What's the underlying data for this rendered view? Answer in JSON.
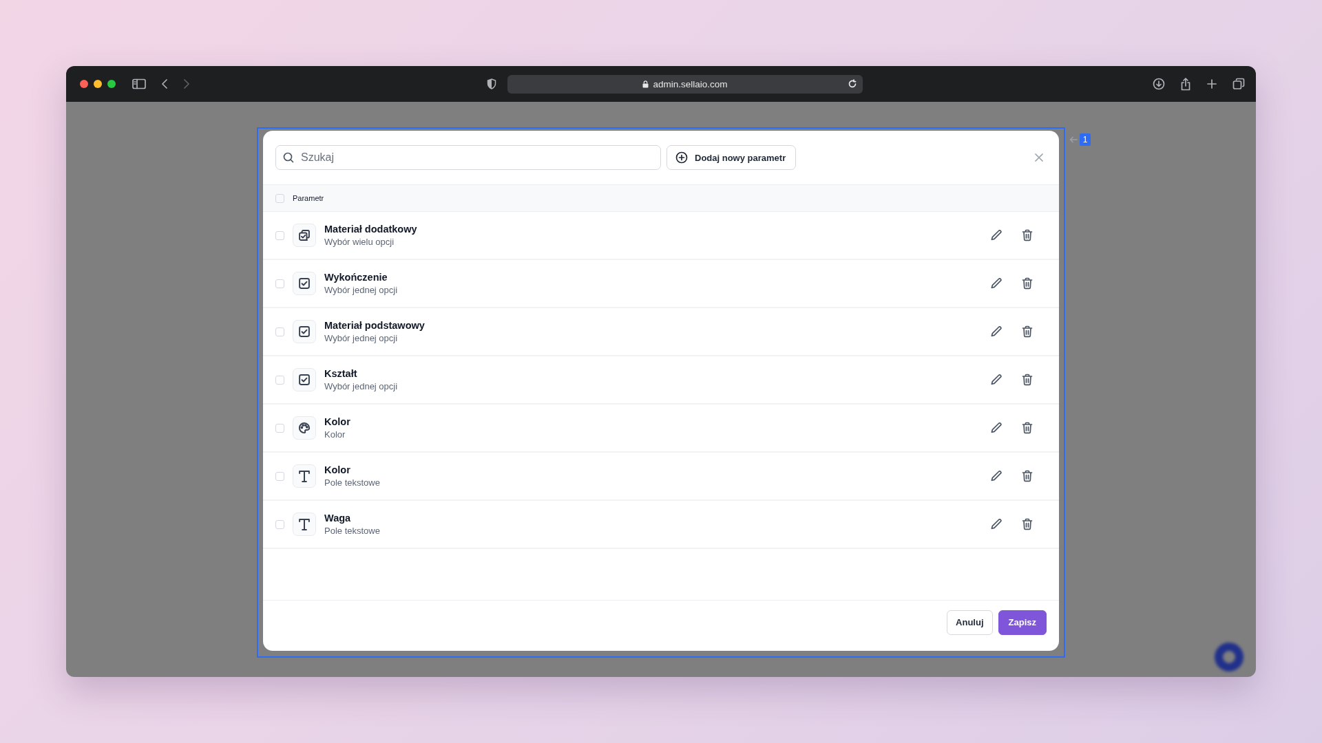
{
  "browser": {
    "url": "admin.sellaio.com"
  },
  "dialog": {
    "search": {
      "placeholder": "Szukaj"
    },
    "add_button": "Dodaj nowy parametr",
    "table": {
      "header_checked": false,
      "column": "Parametr",
      "rows": [
        {
          "name": "Materiał dodatkowy",
          "type": "Wybór wielu opcji",
          "kind": "multi_choice",
          "checked": false
        },
        {
          "name": "Wykończenie",
          "type": "Wybór jednej opcji",
          "kind": "single_choice",
          "checked": false
        },
        {
          "name": "Materiał podstawowy",
          "type": "Wybór jednej opcji",
          "kind": "single_choice",
          "checked": false
        },
        {
          "name": "Kształt",
          "type": "Wybór jednej opcji",
          "kind": "single_choice",
          "checked": false
        },
        {
          "name": "Kolor",
          "type": "Kolor",
          "kind": "color",
          "checked": false
        },
        {
          "name": "Kolor",
          "type": "Pole tekstowe",
          "kind": "text",
          "checked": false
        },
        {
          "name": "Waga",
          "type": "Pole tekstowe",
          "kind": "text",
          "checked": false
        }
      ]
    },
    "buttons": [
      {
        "label": "Anuluj",
        "kind": "secondary"
      },
      {
        "label": "Zapisz",
        "kind": "primary"
      }
    ]
  },
  "selection_badge": "1"
}
